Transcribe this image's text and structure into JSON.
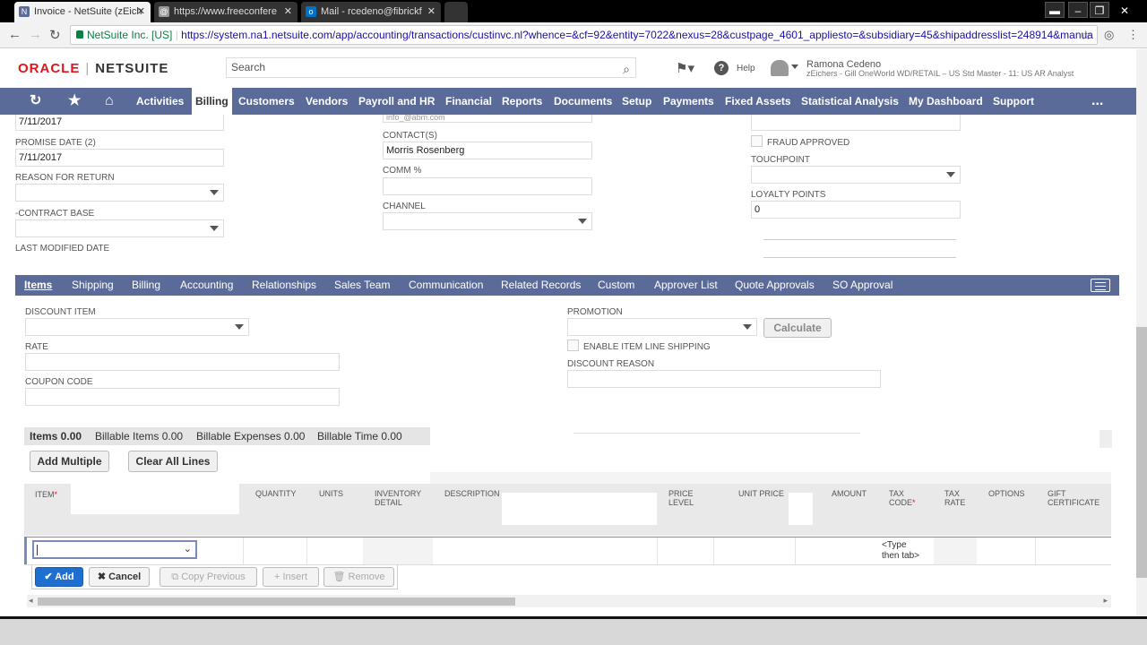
{
  "browser": {
    "tabs": [
      {
        "title": "Invoice - NetSuite (zEich",
        "active": true
      },
      {
        "title": "https://www.freeconfere",
        "active": false
      },
      {
        "title": "Mail - rcedeno@fibrickf",
        "active": false
      }
    ],
    "site_name": "NetSuite Inc. [US]",
    "url": "https://system.na1.netsuite.com/app/accounting/transactions/custinvc.nl?whence=&cf=92&entity=7022&nexus=28&custpage_4601_appliesto=&subsidiary=45&shipaddresslist=248914&manua"
  },
  "header": {
    "logo_oracle": "ORACLE",
    "logo_netsuite": "NETSUITE",
    "search_placeholder": "Search",
    "help_label": "Help",
    "user_name": "Ramona Cedeno",
    "user_role": "zEichers - Gill OneWorld WD/RETAIL – US Std Master - 11: US AR Analyst"
  },
  "menu": {
    "items": [
      "Activities",
      "Billing",
      "Customers",
      "Vendors",
      "Payroll and HR",
      "Financial",
      "Reports",
      "Documents",
      "Setup",
      "Payments",
      "Fixed Assets",
      "Statistical Analysis",
      "My Dashboard",
      "Support"
    ],
    "active": "Billing",
    "more": "..."
  },
  "fields": {
    "top_date": "7/11/2017",
    "top_email_partial": "info_@abm.com",
    "promise_date_label": "PROMISE DATE (2)",
    "promise_date_value": "7/11/2017",
    "reason_for_return_label": "REASON FOR RETURN",
    "contract_base_label": "-CONTRACT BASE",
    "last_modified_label": "LAST MODIFIED DATE",
    "contacts_label": "CONTACT(S)",
    "contacts_value": "Morris Rosenberg",
    "comm_label": "COMM %",
    "channel_label": "CHANNEL",
    "fraud_label": "FRAUD APPROVED",
    "touchpoint_label": "TOUCHPOINT",
    "loyalty_label": "LOYALTY POINTS",
    "loyalty_value": "0"
  },
  "subtabs": {
    "items": [
      "Items",
      "Shipping",
      "Billing",
      "Accounting",
      "Relationships",
      "Sales Team",
      "Communication",
      "Related Records",
      "Custom",
      "Approver List",
      "Quote Approvals",
      "SO Approval"
    ],
    "active": "Items"
  },
  "items_section": {
    "discount_item_label": "DISCOUNT ITEM",
    "rate_label": "RATE",
    "coupon_code_label": "COUPON CODE",
    "promotion_label": "PROMOTION",
    "calculate_label": "Calculate",
    "enable_shipping_label": "ENABLE ITEM LINE SHIPPING",
    "discount_reason_label": "DISCOUNT REASON",
    "summary": {
      "items": "Items 0.00",
      "billable_items": "Billable Items 0.00",
      "billable_expenses": "Billable Expenses 0.00",
      "billable_time": "Billable Time 0.00"
    },
    "add_multiple_label": "Add Multiple",
    "clear_all_label": "Clear All Lines",
    "columns": {
      "item": "ITEM",
      "quantity": "QUANTITY",
      "units": "UNITS",
      "inventory_detail": "INVENTORY\nDETAIL",
      "description": "DESCRIPTION",
      "price_level": "PRICE\nLEVEL",
      "unit_price": "UNIT PRICE",
      "amount": "AMOUNT",
      "tax_code": "TAX\nCODE",
      "tax_rate": "TAX\nRATE",
      "options": "OPTIONS",
      "gift_certificate": "GIFT\nCERTIFICATE"
    },
    "tax_code_hint": "<Type\nthen tab>",
    "actions": {
      "add": "Add",
      "cancel": "Cancel",
      "copy_previous": "Copy Previous",
      "insert": "Insert",
      "remove": "Remove"
    }
  },
  "colors": {
    "menu_bg": "#5a6b9a",
    "oracle_red": "#e0161e",
    "add_button": "#1f6fd1"
  }
}
